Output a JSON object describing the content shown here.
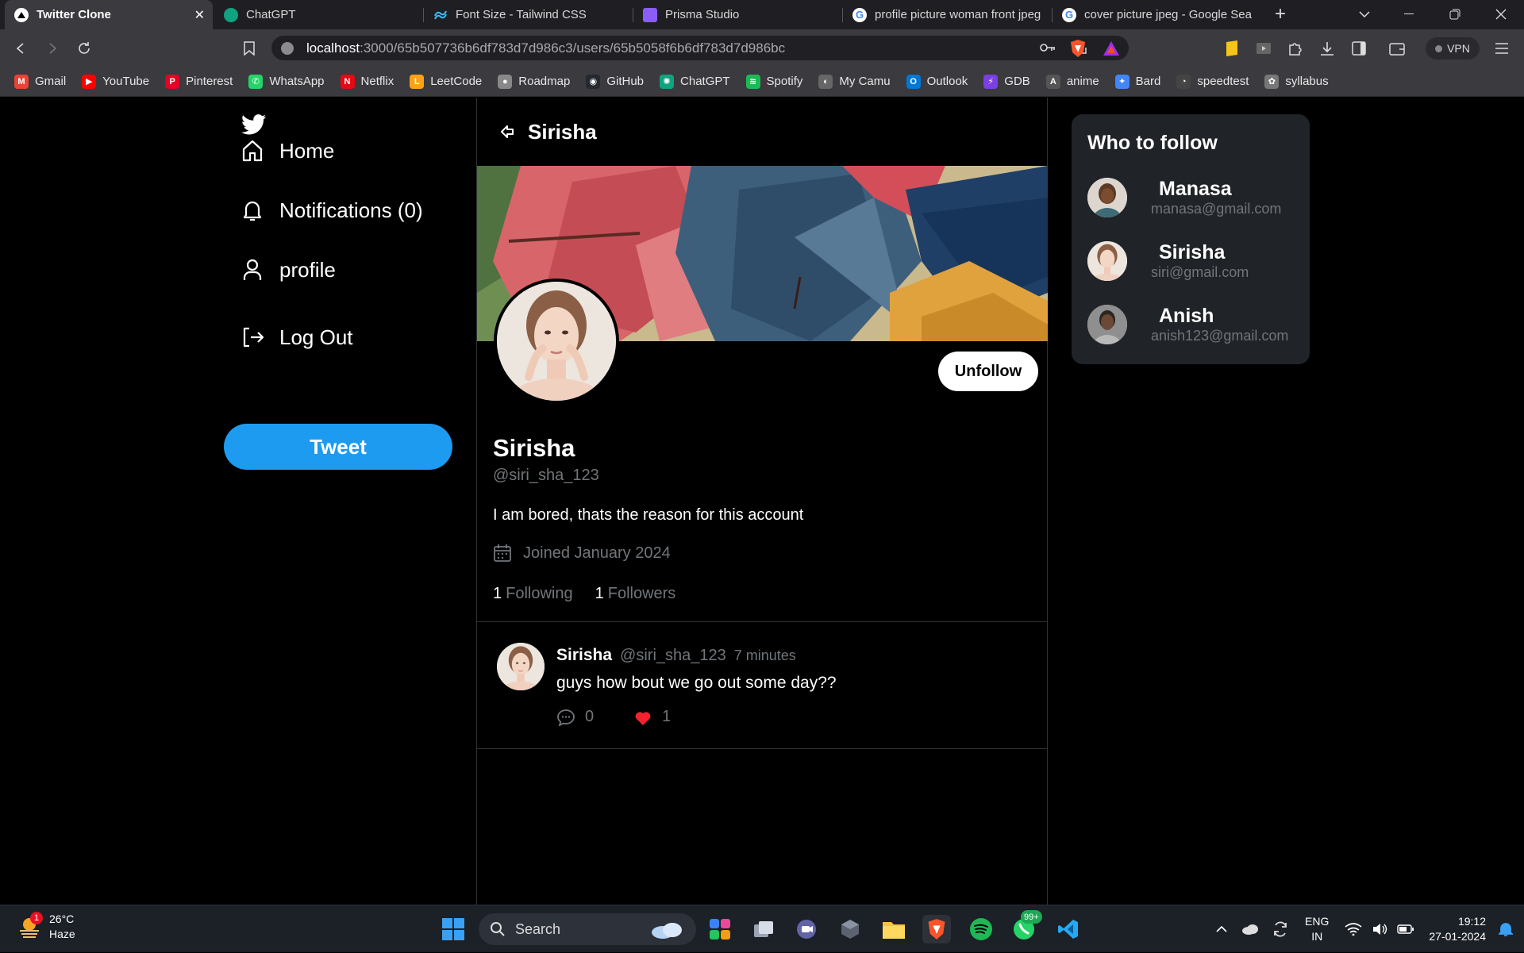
{
  "browser": {
    "tabs": [
      {
        "title": "Twitter Clone",
        "active": true,
        "icon": "twitter-clone-favicon"
      },
      {
        "title": "ChatGPT",
        "icon": "chatgpt-favicon"
      },
      {
        "title": "Font Size - Tailwind CSS",
        "icon": "tailwind-favicon"
      },
      {
        "title": "Prisma Studio",
        "icon": "prisma-favicon"
      },
      {
        "title": "profile picture woman front jpeg",
        "icon": "google-favicon"
      },
      {
        "title": "cover picture jpeg - Google Sear",
        "icon": "google-favicon"
      }
    ],
    "url_host": "localhost",
    "url_path": ":3000/65b507736b6df783d7d986c3/users/65b5058f6b6df783d7d986bc",
    "vpn_label": "VPN",
    "bookmarks": [
      {
        "label": "Gmail",
        "color": "#ea4335",
        "glyph": "M"
      },
      {
        "label": "YouTube",
        "color": "#ff0000",
        "glyph": "▶"
      },
      {
        "label": "Pinterest",
        "color": "#e60023",
        "glyph": "P"
      },
      {
        "label": "WhatsApp",
        "color": "#25d366",
        "glyph": "✆"
      },
      {
        "label": "Netflix",
        "color": "#e50914",
        "glyph": "N"
      },
      {
        "label": "LeetCode",
        "color": "#ffa116",
        "glyph": "L"
      },
      {
        "label": "Roadmap",
        "color": "#888888",
        "glyph": "●"
      },
      {
        "label": "GitHub",
        "color": "#24292f",
        "glyph": "◉"
      },
      {
        "label": "ChatGPT",
        "color": "#10a37f",
        "glyph": "✺"
      },
      {
        "label": "Spotify",
        "color": "#1db954",
        "glyph": "≋"
      },
      {
        "label": "My Camu",
        "color": "#666666",
        "glyph": "◐"
      },
      {
        "label": "Outlook",
        "color": "#0078d4",
        "glyph": "O"
      },
      {
        "label": "GDB",
        "color": "#7b3fe4",
        "glyph": "⚡"
      },
      {
        "label": "anime",
        "color": "#555555",
        "glyph": "A"
      },
      {
        "label": "Bard",
        "color": "#4285f4",
        "glyph": "✦"
      },
      {
        "label": "speedtest",
        "color": "#444444",
        "glyph": "◔"
      },
      {
        "label": "syllabus",
        "color": "#777777",
        "glyph": "✿"
      }
    ]
  },
  "nav": {
    "home": "Home",
    "notifications": "Notifications (0)",
    "profile": "profile",
    "logout": "Log Out",
    "tweet": "Tweet"
  },
  "profile": {
    "header_title": "Sirisha",
    "name": "Sirisha",
    "handle": "@siri_sha_123",
    "bio": "I am bored, thats the reason for this account",
    "joined": "Joined January 2024",
    "following_count": "1",
    "following_label": "Following",
    "followers_count": "1",
    "followers_label": "Followers",
    "unfollow_label": "Unfollow"
  },
  "post": {
    "name": "Sirisha",
    "handle": "@siri_sha_123",
    "time": "7 minutes",
    "text": "guys how bout we go out some day??",
    "comments": "0",
    "likes": "1"
  },
  "who_to_follow": {
    "title": "Who to follow",
    "users": [
      {
        "name": "Manasa",
        "email": "manasa@gmail.com"
      },
      {
        "name": "Sirisha",
        "email": "siri@gmail.com"
      },
      {
        "name": "Anish",
        "email": "anish123@gmail.com"
      }
    ]
  },
  "taskbar": {
    "temperature": "26°C",
    "weather": "Haze",
    "weather_badge": "1",
    "search_placeholder": "Search",
    "whatsapp_badge": "99+",
    "language": "ENG",
    "region": "IN",
    "time": "19:12",
    "date": "27-01-2024"
  },
  "colors": {
    "accent": "#1d9bf0",
    "like": "#f91880",
    "muted_text": "#71767b"
  }
}
